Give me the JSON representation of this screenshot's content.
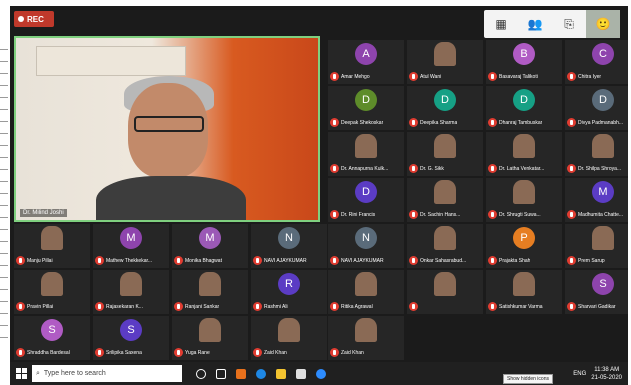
{
  "recording": {
    "label": "REC"
  },
  "speaker": {
    "name": "Dr. Milind Joshi"
  },
  "participants": [
    {
      "name": "Amar Mehgo",
      "initial": "A",
      "color": "#8e44ad"
    },
    {
      "name": "Atul Wani",
      "initial": "",
      "color": "#5a5a5a"
    },
    {
      "name": "Basavaraj Talikoti",
      "initial": "B",
      "color": "#b05bc4"
    },
    {
      "name": "Chitra Iyer",
      "initial": "C",
      "color": "#8e44ad"
    },
    {
      "name": "Deepak Shekoskar",
      "initial": "D",
      "color": "#5e8c2a"
    },
    {
      "name": "Deepika Sharma",
      "initial": "D",
      "color": "#16a085"
    },
    {
      "name": "Dhanraj Tambuskar",
      "initial": "D",
      "color": "#16a085"
    },
    {
      "name": "Divya Padmanabh...",
      "initial": "D",
      "color": "#5a6b7a"
    },
    {
      "name": "Dr. Annapurna Kulk...",
      "initial": "",
      "color": "#5a5a5a"
    },
    {
      "name": "Dr. G. Sikk",
      "initial": "",
      "color": "#5a5a5a"
    },
    {
      "name": "Dr. Latha Venkatar...",
      "initial": "",
      "color": "#5a5a5a"
    },
    {
      "name": "Dr. Shilpa Shroya...",
      "initial": "",
      "color": "#5a5a5a"
    },
    {
      "name": "Dr. Rini Francis",
      "initial": "D",
      "color": "#5b3cc4"
    },
    {
      "name": "Dr. Sachin Hans...",
      "initial": "",
      "color": "#5a5a5a"
    },
    {
      "name": "Dr. Shrugti Suwa...",
      "initial": "",
      "color": "#5a5a5a"
    },
    {
      "name": "Madhumita Chatte...",
      "initial": "M",
      "color": "#5b3cc4"
    },
    {
      "name": "Manju Pillai",
      "initial": "",
      "color": "#5a5a5a"
    },
    {
      "name": "Mathew Thekkekar...",
      "initial": "M",
      "color": "#8e44ad"
    },
    {
      "name": "Monika Bhagwat",
      "initial": "M",
      "color": "#9b59b6"
    },
    {
      "name": "NAVI AJAYKUMAR",
      "initial": "N",
      "color": "#5a6b7a"
    },
    {
      "name": "NAVI AJAYKUMAR",
      "initial": "N",
      "color": "#5a6b7a"
    },
    {
      "name": "Onkar Sahasrabud...",
      "initial": "",
      "color": "#5a5a5a"
    },
    {
      "name": "Prajakta Shah",
      "initial": "P",
      "color": "#e67e22"
    },
    {
      "name": "Prem Sarup",
      "initial": "",
      "color": "#5a5a5a"
    },
    {
      "name": "Pravin Pillai",
      "initial": "",
      "color": "#5a5a5a"
    },
    {
      "name": "Rajasekaran K...",
      "initial": "",
      "color": "#5a5a5a"
    },
    {
      "name": "Ranjani Sankar",
      "initial": "",
      "color": "#5a5a5a"
    },
    {
      "name": "Rashmi Ali",
      "initial": "R",
      "color": "#5b3cc4"
    },
    {
      "name": "Ritika Agrawal",
      "initial": "",
      "color": "#5a5a5a"
    },
    {
      "name": "",
      "initial": "",
      "color": "#5a5a5a"
    },
    {
      "name": "Satishkumar Varma",
      "initial": "",
      "color": "#5a5a5a"
    },
    {
      "name": "Sharvari Gadikar",
      "initial": "S",
      "color": "#8e44ad"
    },
    {
      "name": "Shraddha Bardesal",
      "initial": "S",
      "color": "#b05bc4"
    },
    {
      "name": "Srilipika Saxena",
      "initial": "S",
      "color": "#5b3cc4"
    },
    {
      "name": "Yuga Rane",
      "initial": "",
      "color": "#5a5a5a"
    },
    {
      "name": "Zaid Khan",
      "initial": "",
      "color": "#5a5a5a"
    },
    {
      "name": "Zaid Khan",
      "initial": "",
      "color": "#5a5a5a"
    }
  ],
  "taskbar": {
    "search_placeholder": "Type here to search",
    "lang": "ENG",
    "time": "11:38 AM",
    "date": "21-05-2020",
    "tooltip": "Show hidden icons"
  }
}
